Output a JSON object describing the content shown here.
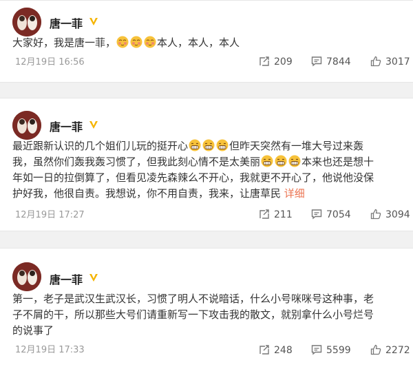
{
  "posts": [
    {
      "author": "唐一菲",
      "text_before": "大家好，我是唐一菲，",
      "text_after": "本人，本人，本人",
      "time": "12月19日 16:56",
      "reposts": "209",
      "comments": "7844",
      "likes": "3017"
    },
    {
      "author": "唐一菲",
      "line1_a": "最近跟新认识的几个姐们儿玩的挺开心",
      "line1_b": "但昨天突然有一堆大号过来轰",
      "line2_a": "我，虽然你们轰我轰习惯了，但我此刻心情不是太美丽",
      "line2_b": "本来也还是想十",
      "line3": "年如一日的拉倒算了，但看见凌先森辣么不开心，我就更不开心了，他说他没保",
      "line4": "护好我，他很自责。我想说，你不用自责，我来，让唐草民",
      "more": "详细",
      "time": "12月19日 17:27",
      "reposts": "211",
      "comments": "7054",
      "likes": "3094"
    },
    {
      "author": "唐一菲",
      "line1": "第一，老子是武汉生武汉长，习惯了明人不说暗话，什么小号咪咪号这种事，老",
      "line2": "子不屑的干，所以那些大号们请重新写一下攻击我的散文，就别拿什么小号烂号",
      "line3": "的说事了",
      "time": "12月19日 17:33",
      "reposts": "248",
      "comments": "5599",
      "likes": "2272"
    }
  ],
  "icons": {
    "repost": "repost-icon",
    "comment": "comment-icon",
    "like": "like-icon",
    "verified": "verified-badge-icon"
  },
  "colors": {
    "accent": "#eb7350",
    "badge": "#f5b400"
  }
}
